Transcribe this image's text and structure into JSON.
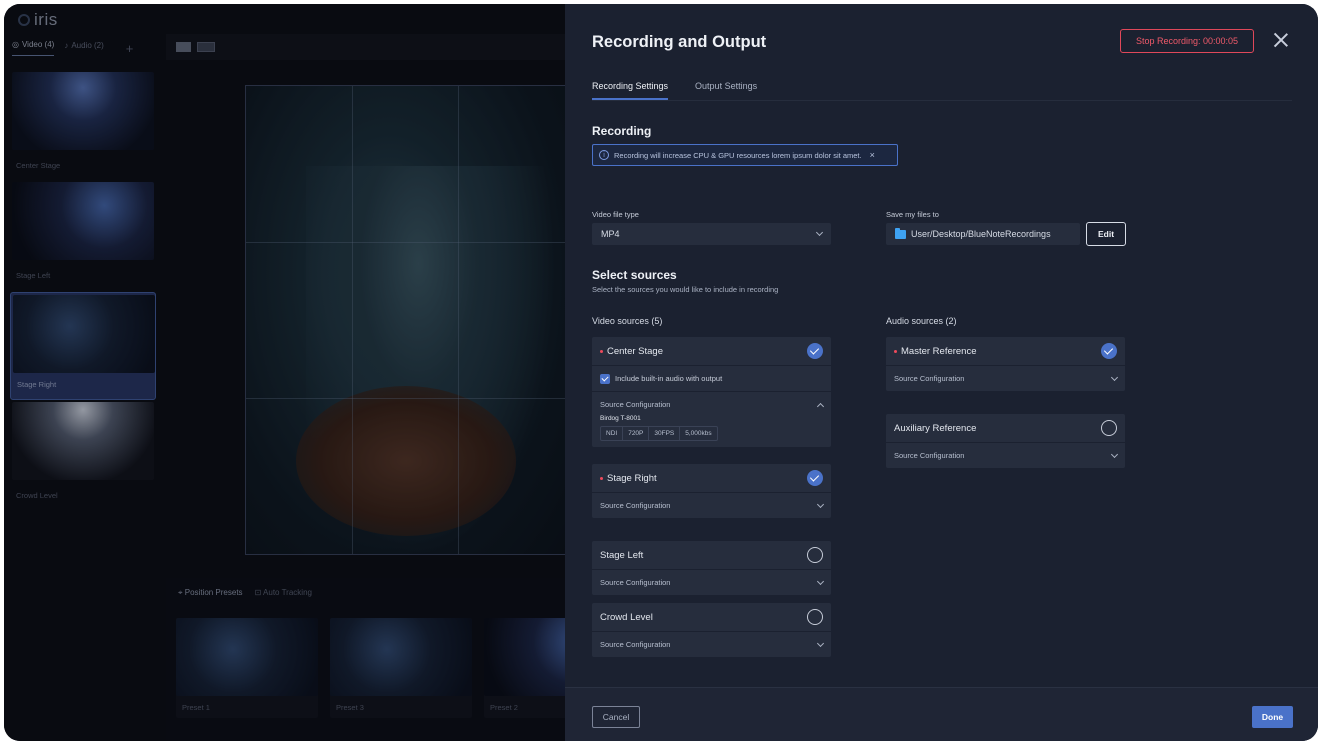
{
  "app": {
    "logo_text": "iris"
  },
  "background": {
    "source_tabs": [
      {
        "label": "Video (4)"
      },
      {
        "label": "Audio (2)"
      }
    ],
    "add_label": "+",
    "thumbnails": [
      {
        "label": "Center Stage"
      },
      {
        "label": "Stage Left"
      },
      {
        "label": "Stage Right"
      },
      {
        "label": "Crowd Level"
      }
    ],
    "preset_tabs": [
      {
        "label": "Position Presets"
      },
      {
        "label": "Auto Tracking"
      }
    ],
    "presets": [
      {
        "label": "Preset 1"
      },
      {
        "label": "Preset 3"
      },
      {
        "label": "Preset 2"
      }
    ]
  },
  "modal": {
    "title": "Recording and Output",
    "stop_recording_label": "Stop Recording: 00:00:05",
    "tabs": [
      {
        "label": "Recording Settings"
      },
      {
        "label": "Output Settings"
      }
    ],
    "recording": {
      "title": "Recording",
      "info_text": "Recording will increase CPU & GPU resources lorem ipsum dolor sit amet.",
      "file_type_label": "Video file type",
      "file_type_value": "MP4",
      "save_label": "Save my files to",
      "save_path": "User/Desktop/BlueNoteRecordings",
      "edit_label": "Edit"
    },
    "sources": {
      "title": "Select sources",
      "subtitle": "Select the sources you would like to include in recording",
      "video_label": "Video sources (5)",
      "audio_label": "Audio sources (2)",
      "source_config_label": "Source Configuration",
      "include_audio_label": "Include built-in audio with output",
      "video": [
        {
          "name": "Center Stage",
          "selected": true,
          "device": "Birdog T-8001",
          "specs": [
            "NDI",
            "720P",
            "30FPS",
            "5,000kbs"
          ]
        },
        {
          "name": "Stage Right",
          "selected": true
        },
        {
          "name": "Stage Left",
          "selected": false
        },
        {
          "name": "Crowd Level",
          "selected": false
        }
      ],
      "audio": [
        {
          "name": "Master Reference",
          "selected": true
        },
        {
          "name": "Auxiliary Reference",
          "selected": false
        }
      ]
    },
    "footer": {
      "cancel_label": "Cancel",
      "done_label": "Done"
    }
  },
  "colors": {
    "accent": "#4a72c9",
    "danger": "#e0485a",
    "panel": "#1b2130",
    "card": "#262d3d",
    "folder": "#3ea2f2"
  }
}
